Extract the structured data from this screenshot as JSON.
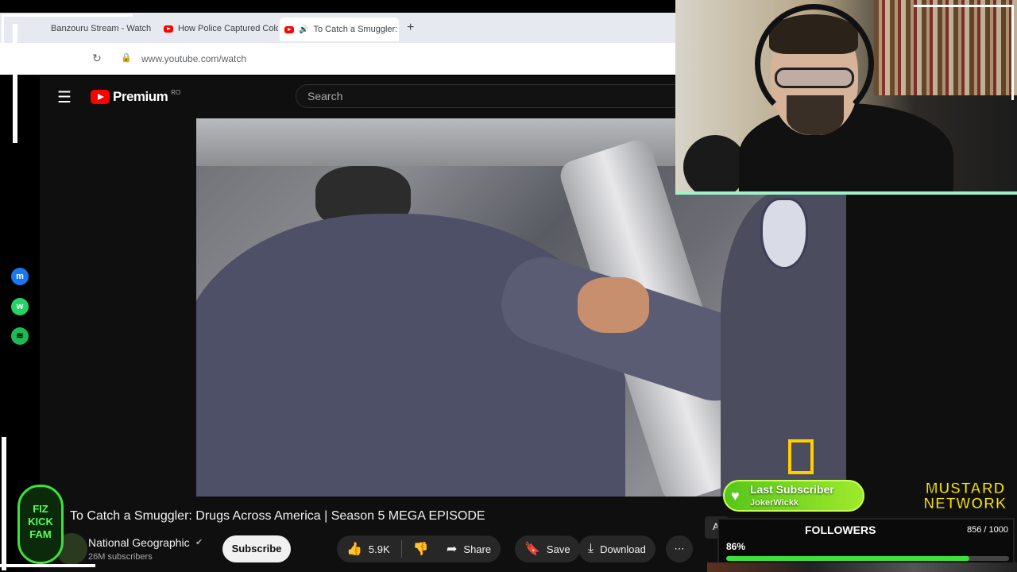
{
  "browser": {
    "tabs": [
      {
        "label": "Banzouru Stream - Watch"
      },
      {
        "label": "How Police Captured Colo"
      },
      {
        "label": "To Catch a Smuggler:"
      }
    ],
    "new_tab_label": "+",
    "url": "www.youtube.com/watch"
  },
  "youtube": {
    "logo_text": "Premium",
    "logo_country": "RO",
    "search_placeholder": "Search",
    "video_title": "To Catch a Smuggler: Drugs Across America | Season 5 MEGA EPISODE",
    "channel_name": "National Geographic",
    "subscribers": "26M subscribers",
    "subscribe_label": "Subscribe",
    "like_count": "5.9K",
    "share_label": "Share",
    "save_label": "Save",
    "download_label": "Download",
    "side_chip": "A"
  },
  "overlay": {
    "last_sub_label": "Last Subscriber",
    "last_sub_name": "JokerWickk",
    "network_logo": "MUSTARD NETWORK",
    "kick_logo_text": "FIZ KICK FAM",
    "followers_title": "FOLLOWERS",
    "followers_count": "856 / 1000",
    "followers_percent": "86%",
    "followers_fraction": 0.86
  },
  "icons": {
    "sidebar": [
      "messenger-icon",
      "whatsapp-icon",
      "spotify-icon"
    ],
    "player": [
      "natgeo-logo-icon"
    ]
  },
  "colors": {
    "youtube_red": "#ff0000",
    "follower_bar": "#3ae23a",
    "last_sub_green": "#57c51b",
    "network_yellow": "#ffe900"
  }
}
